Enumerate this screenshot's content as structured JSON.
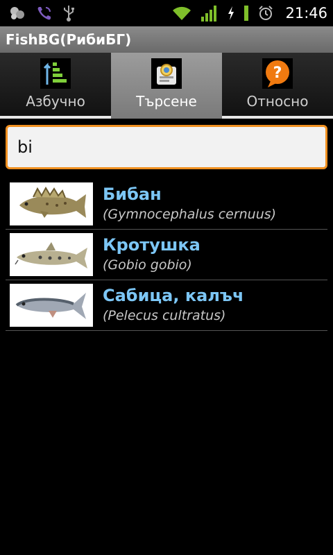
{
  "status_bar": {
    "time": "21:46",
    "icons": [
      "app-notification-icon",
      "viber-icon",
      "usb-icon",
      "wifi-icon",
      "signal-icon",
      "charging-icon",
      "battery-icon",
      "alarm-icon"
    ]
  },
  "app": {
    "title": "FishBG(РибиБГ)"
  },
  "tabs": [
    {
      "label": "Азбучно",
      "icon": "alphabetical-sort-icon",
      "selected": false
    },
    {
      "label": "Търсене",
      "icon": "search-tab-icon",
      "selected": true
    },
    {
      "label": "Относно",
      "icon": "question-icon",
      "selected": false
    }
  ],
  "search": {
    "value": "bi"
  },
  "fish": [
    {
      "name": "Бибан",
      "latin": "(Gymnocephalus cernuus)",
      "image": "ruffe-fish-image"
    },
    {
      "name": "Кротушка",
      "latin": "(Gobio gobio)",
      "image": "gudgeon-fish-image"
    },
    {
      "name": "Сабица, калъч",
      "latin": "(Pelecus cultratus)",
      "image": "sabre-carp-fish-image"
    }
  ],
  "colors": {
    "accent": "#f09020",
    "link": "#7cc6f5",
    "tab_selected": "#8c8c8c"
  }
}
